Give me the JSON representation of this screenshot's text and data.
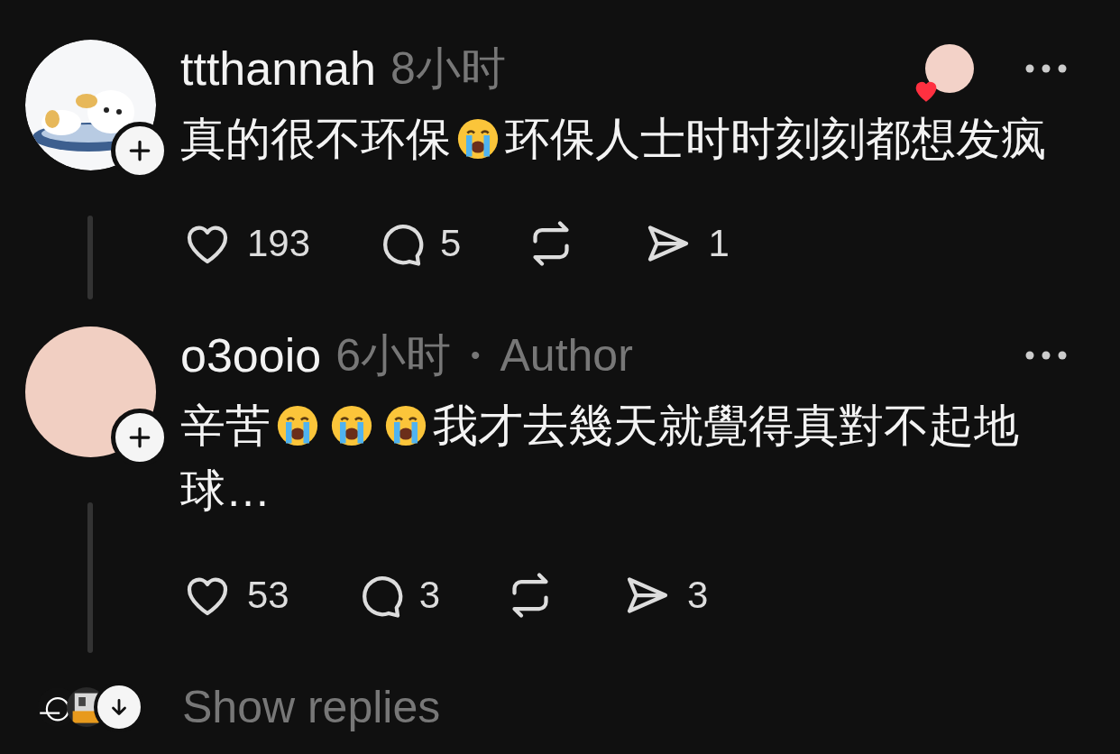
{
  "comments": [
    {
      "username": "ttthannah",
      "time": "8小时",
      "author_reaction": true,
      "avatar": {
        "kind": "picture"
      },
      "lines": [
        [
          {
            "kind": "text",
            "text": "真的很不环保"
          },
          {
            "kind": "emoji"
          },
          {
            "kind": "text",
            "text": "环保人士时时刻刻都想发疯"
          }
        ]
      ],
      "likes": "193",
      "replies": "5",
      "shares": "1"
    },
    {
      "username": "o3ooio",
      "time": "6小时",
      "separator": "•",
      "badge": "Author",
      "author_reaction": false,
      "avatar": {
        "kind": "plain"
      },
      "lines": [
        [
          {
            "kind": "text",
            "text": "辛苦"
          },
          {
            "kind": "emoji"
          },
          {
            "kind": "emoji"
          },
          {
            "kind": "emoji"
          },
          {
            "kind": "text",
            "text": "我才去幾天就覺得真對不起地"
          }
        ],
        [
          {
            "kind": "text",
            "text": "球…"
          }
        ]
      ],
      "likes": "53",
      "replies": "3",
      "shares": "3"
    }
  ],
  "show_replies": {
    "label": "Show replies"
  }
}
